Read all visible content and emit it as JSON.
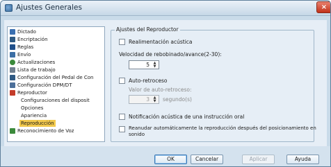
{
  "window": {
    "title": "Ajustes Generales",
    "close_glyph": "×"
  },
  "tree": {
    "items": [
      {
        "label": "Dictado",
        "icon": "dictation-icon",
        "color": "#3a6fb0",
        "level": 0
      },
      {
        "label": "Encriptación",
        "icon": "lock-icon",
        "color": "#2f5a83",
        "level": 0
      },
      {
        "label": "Reglas",
        "icon": "section-icon",
        "color": "#1f4f8a",
        "level": 0
      },
      {
        "label": "Envío",
        "icon": "envelope-icon",
        "color": "#3c6fa5",
        "level": 0
      },
      {
        "label": "Actualizaciones",
        "icon": "globe-icon",
        "color": "#3b8a3b",
        "level": 0
      },
      {
        "label": "Lista de trabajo",
        "icon": "list-icon",
        "color": "#6f7f8f",
        "level": 0
      },
      {
        "label": "Configuración del Pedal de Con",
        "icon": "pedal-icon",
        "color": "#2f5a83",
        "level": 0
      },
      {
        "label": "Configuración DPM/DT",
        "icon": "device-icon",
        "color": "#4b6f9a",
        "level": 0
      },
      {
        "label": "Reproductor",
        "icon": "player-icon",
        "color": "#c43c2a",
        "level": 0
      },
      {
        "label": "Configuraciones del disposit",
        "icon": "",
        "color": "",
        "level": 1
      },
      {
        "label": "Opciones",
        "icon": "",
        "color": "",
        "level": 1
      },
      {
        "label": "Apariencia",
        "icon": "",
        "color": "",
        "level": 1
      },
      {
        "label": "Reproducción",
        "icon": "",
        "color": "",
        "level": 1,
        "selected": true
      },
      {
        "label": "Reconocimiento de Voz",
        "icon": "speech-icon",
        "color": "#3b8a3b",
        "level": 0
      }
    ]
  },
  "reproductor": {
    "group_title": "Ajustes del Reproductor",
    "realimentacion_label": "Realimentación acústica",
    "velocidad_label": "Velocidad de rebobinado/avance(2-30):",
    "velocidad_value": "5",
    "autoretroceso_label": "Auto-retroceso",
    "valor_label": "Valor de auto-retroceso:",
    "valor_value": "3",
    "segundos_label": "segundo(s)",
    "notificacion_label": "Notificación acústica de una instrucción oral",
    "reanudar_label": "Reanudar automáticamente la reproducción después del posicionamiento en",
    "reanudar_label_2": "sonido"
  },
  "buttons": {
    "ok": "OK",
    "cancel": "Cancelar",
    "apply": "Aplicar",
    "help": "Ayuda"
  }
}
